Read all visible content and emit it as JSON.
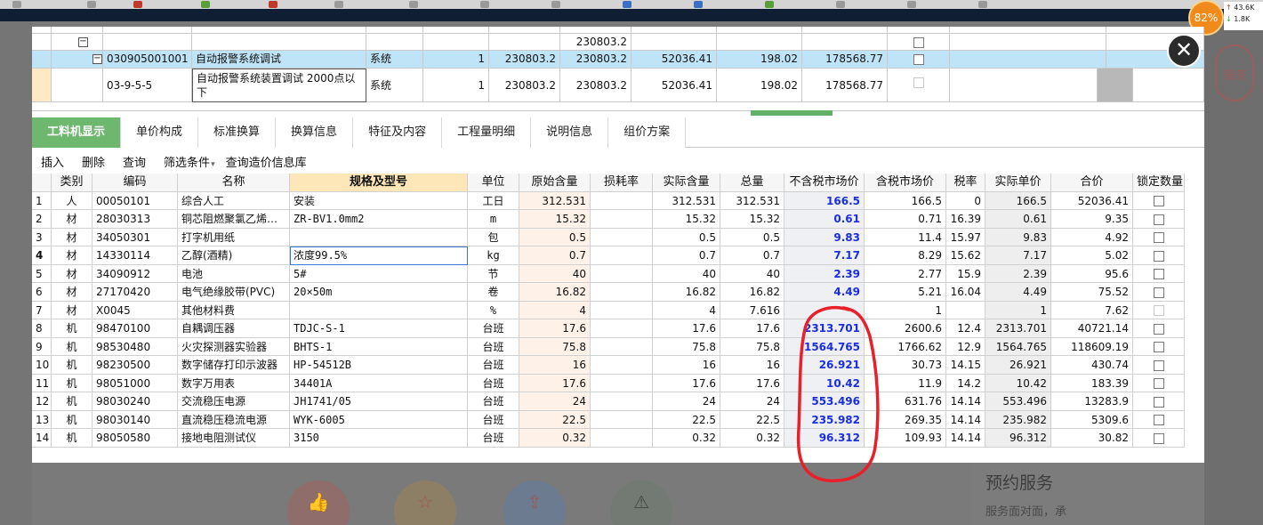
{
  "perf_widget": {
    "percent": "82%",
    "up": "43.6K",
    "down": "1.8K"
  },
  "background_page": {
    "service_title": "预约服务",
    "service_sub": "服务面对面，承",
    "cloud_label": "服务"
  },
  "upper_grid": {
    "rows": [
      {
        "seq": "",
        "code": "",
        "name": "",
        "unit": "",
        "qty": "",
        "price": "",
        "total": "230803.2",
        "labor": "",
        "material": "",
        "machine": "",
        "c1": ""
      },
      {
        "seq": "1",
        "code": "030905001001",
        "name": "自动报警系统调试",
        "unit": "系统",
        "qty": "1",
        "price": "230803.2",
        "total": "230803.2",
        "labor": "52036.41",
        "material": "198.02",
        "machine": "178568.77"
      },
      {
        "seq": "",
        "code": "03-9-5-5",
        "name": "自动报警系统装置调试 2000点以下",
        "unit": "系统",
        "qty": "1",
        "price": "230803.2",
        "total": "230803.2",
        "labor": "52036.41",
        "material": "198.02",
        "machine": "178568.77"
      }
    ]
  },
  "tabs": [
    "工料机显示",
    "单价构成",
    "标准换算",
    "换算信息",
    "特征及内容",
    "工程量明细",
    "说明信息",
    "组价方案"
  ],
  "toolbar": {
    "insert": "插入",
    "delete": "删除",
    "query": "查询",
    "filter": "筛选条件",
    "price_db": "查询造价信息库"
  },
  "grid_headers": [
    "",
    "类别",
    "编码",
    "名称",
    "规格及型号",
    "单位",
    "原始含量",
    "损耗率",
    "实际含量",
    "总量",
    "不含税市场价",
    "含税市场价",
    "税率",
    "实际单价",
    "合价",
    "锁定数量"
  ],
  "grid_rows": [
    {
      "n": "1",
      "type": "人",
      "code": "00050101",
      "name": "综合人工",
      "spec": "安装",
      "unit": "工日",
      "orig": "312.531",
      "loss": "",
      "actual": "312.531",
      "total": "312.531",
      "mkt": "166.5",
      "mkt_tax": "166.5",
      "rate": "0",
      "unit_price": "166.5",
      "sum": "52036.41"
    },
    {
      "n": "2",
      "type": "材",
      "code": "28030313",
      "name": "铜芯阻燃聚氯乙烯…",
      "spec": "ZR-BV1.0mm2",
      "unit": "m",
      "orig": "15.32",
      "loss": "",
      "actual": "15.32",
      "total": "15.32",
      "mkt": "0.61",
      "mkt_tax": "0.71",
      "rate": "16.39",
      "unit_price": "0.61",
      "sum": "9.35"
    },
    {
      "n": "3",
      "type": "材",
      "code": "34050301",
      "name": "打字机用纸",
      "spec": "",
      "unit": "包",
      "orig": "0.5",
      "loss": "",
      "actual": "0.5",
      "total": "0.5",
      "mkt": "9.83",
      "mkt_tax": "11.4",
      "rate": "15.97",
      "unit_price": "9.83",
      "sum": "4.92"
    },
    {
      "n": "4",
      "type": "材",
      "code": "14330114",
      "name": "乙醇(酒精)",
      "spec": "浓度99.5%",
      "unit": "kg",
      "orig": "0.7",
      "loss": "",
      "actual": "0.7",
      "total": "0.7",
      "mkt": "7.17",
      "mkt_tax": "8.29",
      "rate": "15.62",
      "unit_price": "7.17",
      "sum": "5.02"
    },
    {
      "n": "5",
      "type": "材",
      "code": "34090912",
      "name": "电池",
      "spec": "5#",
      "unit": "节",
      "orig": "40",
      "loss": "",
      "actual": "40",
      "total": "40",
      "mkt": "2.39",
      "mkt_tax": "2.77",
      "rate": "15.9",
      "unit_price": "2.39",
      "sum": "95.6"
    },
    {
      "n": "6",
      "type": "材",
      "code": "27170420",
      "name": "电气绝缘胶带(PVC)",
      "spec": "20×50m",
      "unit": "卷",
      "orig": "16.82",
      "loss": "",
      "actual": "16.82",
      "total": "16.82",
      "mkt": "4.49",
      "mkt_tax": "5.21",
      "rate": "16.04",
      "unit_price": "4.49",
      "sum": "75.52"
    },
    {
      "n": "7",
      "type": "材",
      "code": "X0045",
      "name": "其他材料费",
      "spec": "",
      "unit": "%",
      "orig": "4",
      "loss": "",
      "actual": "4",
      "total": "7.616",
      "mkt": "",
      "mkt_tax": "1",
      "rate": "",
      "unit_price": "1",
      "sum": "7.62"
    },
    {
      "n": "8",
      "type": "机",
      "code": "98470100",
      "name": "自耦调压器",
      "spec": "TDJC-S-1",
      "unit": "台班",
      "orig": "17.6",
      "loss": "",
      "actual": "17.6",
      "total": "17.6",
      "mkt": "2313.701",
      "mkt_tax": "2600.6",
      "rate": "12.4",
      "unit_price": "2313.701",
      "sum": "40721.14"
    },
    {
      "n": "9",
      "type": "机",
      "code": "98530480",
      "name": "火灾探测器实验器",
      "spec": "BHTS-1",
      "unit": "台班",
      "orig": "75.8",
      "loss": "",
      "actual": "75.8",
      "total": "75.8",
      "mkt": "1564.765",
      "mkt_tax": "1766.62",
      "rate": "12.9",
      "unit_price": "1564.765",
      "sum": "118609.19"
    },
    {
      "n": "10",
      "type": "机",
      "code": "98230500",
      "name": "数字储存打印示波器",
      "spec": "HP-54512B",
      "unit": "台班",
      "orig": "16",
      "loss": "",
      "actual": "16",
      "total": "16",
      "mkt": "26.921",
      "mkt_tax": "30.73",
      "rate": "14.15",
      "unit_price": "26.921",
      "sum": "430.74"
    },
    {
      "n": "11",
      "type": "机",
      "code": "98051000",
      "name": "数字万用表",
      "spec": "34401A",
      "unit": "台班",
      "orig": "17.6",
      "loss": "",
      "actual": "17.6",
      "total": "17.6",
      "mkt": "10.42",
      "mkt_tax": "11.9",
      "rate": "14.2",
      "unit_price": "10.42",
      "sum": "183.39"
    },
    {
      "n": "12",
      "type": "机",
      "code": "98030240",
      "name": "交流稳压电源",
      "spec": "JH1741/05",
      "unit": "台班",
      "orig": "24",
      "loss": "",
      "actual": "24",
      "total": "24",
      "mkt": "553.496",
      "mkt_tax": "631.76",
      "rate": "14.14",
      "unit_price": "553.496",
      "sum": "13283.9"
    },
    {
      "n": "13",
      "type": "机",
      "code": "98030140",
      "name": "直流稳压稳流电源",
      "spec": "WYK-6005",
      "unit": "台班",
      "orig": "22.5",
      "loss": "",
      "actual": "22.5",
      "total": "22.5",
      "mkt": "235.982",
      "mkt_tax": "269.35",
      "rate": "14.14",
      "unit_price": "235.982",
      "sum": "5309.6"
    },
    {
      "n": "14",
      "type": "机",
      "code": "98050580",
      "name": "接地电阻测试仪",
      "spec": "3150",
      "unit": "台班",
      "orig": "0.32",
      "loss": "",
      "actual": "0.32",
      "total": "0.32",
      "mkt": "96.312",
      "mkt_tax": "109.93",
      "rate": "14.14",
      "unit_price": "96.312",
      "sum": "30.82"
    }
  ],
  "colors": {
    "tab_active": "#6db76f",
    "market_price_text": "#1a2ee0",
    "annotation_red": "#e8202a",
    "selected_row": "#bfe4f7"
  }
}
